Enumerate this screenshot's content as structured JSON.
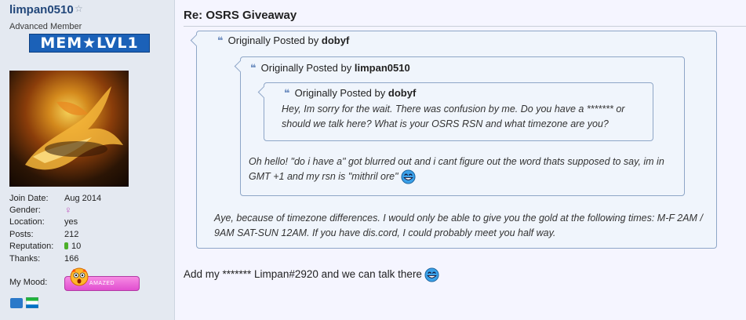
{
  "user": {
    "name": "limpan0510",
    "rank": "Advanced Member",
    "badge": "MEM★LVL1",
    "fields": [
      {
        "key": "Join Date:",
        "value": "Aug 2014"
      },
      {
        "key": "Gender:",
        "value": "♀"
      },
      {
        "key": "Location:",
        "value": "yes"
      },
      {
        "key": "Posts:",
        "value": "212"
      },
      {
        "key": "Reputation:",
        "value": "10"
      },
      {
        "key": "Thanks:",
        "value": "166"
      }
    ],
    "mood_label": "My Mood:",
    "mood": "AMAZED"
  },
  "post": {
    "title": "Re: OSRS Giveaway",
    "quote_prefix": "Originally Posted by",
    "quote1_author": "dobyf",
    "quote2_author": "limpan0510",
    "quote3_author": "dobyf",
    "quote3_text": "Hey, Im sorry for the wait. There was confusion by me. Do you have a ******* or should we talk here? What is your OSRS RSN and what timezone are you?",
    "quote2_text": "Oh hello! \"do i have a\" got blurred out and i cant figure out the word thats supposed to say, im in GMT +1 and my rsn is \"mithril ore\"",
    "quote1_text": "Aye, because of timezone differences. I would only be able to give you the gold at the following times: M-F 2AM / 9AM SAT-SUN 12AM. If you have dis.cord, I could probably meet you half way.",
    "body": "Add my ******* Limpan#2920 and we can talk there"
  },
  "colors": {
    "username": "#22477a",
    "quote_border": "#8ea6c7",
    "quote_bg": "#f0f5fc",
    "badge": "#1b61b8"
  }
}
